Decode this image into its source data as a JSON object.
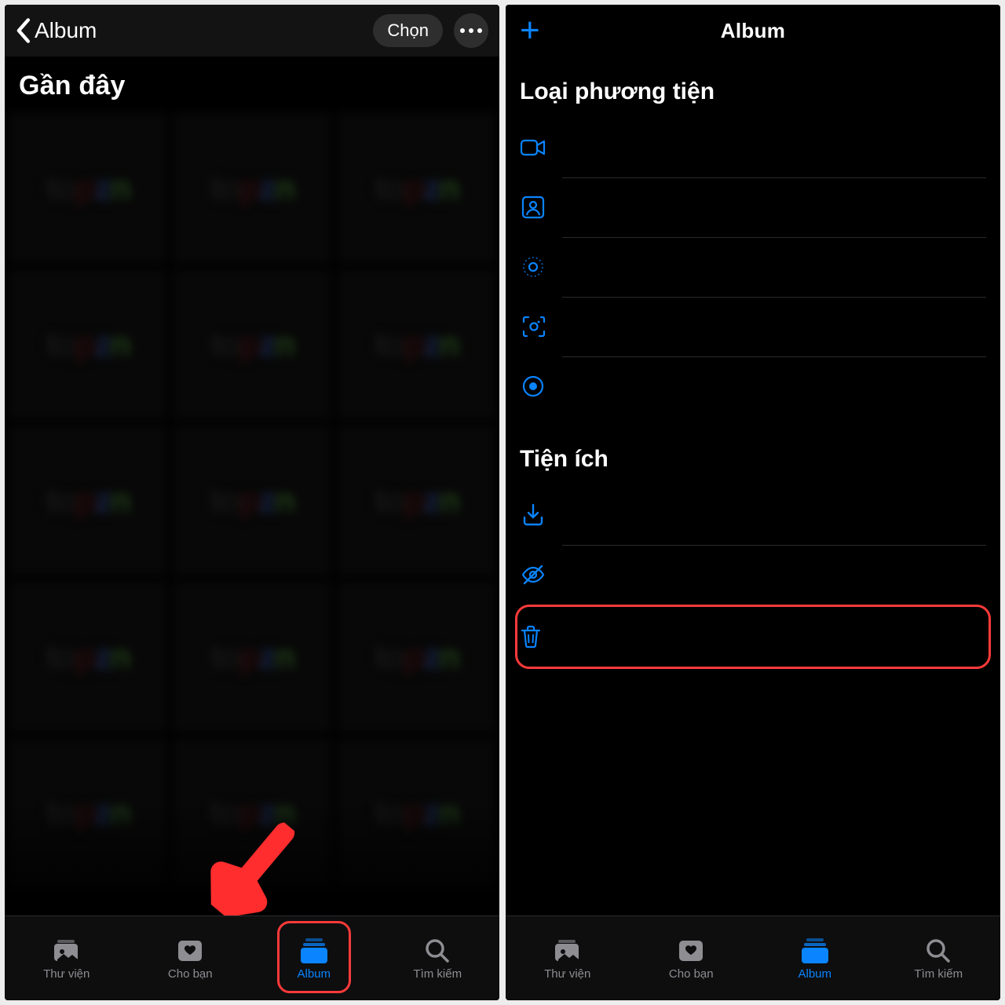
{
  "left": {
    "back_label": "Album",
    "select_label": "Chọn",
    "section_title": "Gần đây"
  },
  "right": {
    "title": "Album",
    "media_types_header": "Loại phương tiện",
    "utilities_header": "Tiện ích",
    "media_rows": [
      {
        "label": "Video"
      },
      {
        "label": "Ảnh selfie"
      },
      {
        "label": "Live Photos"
      },
      {
        "label": "Ảnh màn hình"
      },
      {
        "label": "Bản ghi màn hình"
      }
    ],
    "util_rows": [
      {
        "label": "Nhập"
      },
      {
        "label": "Bị ẩn"
      },
      {
        "label": "Đã xóa gần đây"
      }
    ]
  },
  "tabs": {
    "library": "Thư viện",
    "for_you": "Cho bạn",
    "album": "Album",
    "search": "Tìm kiếm"
  }
}
